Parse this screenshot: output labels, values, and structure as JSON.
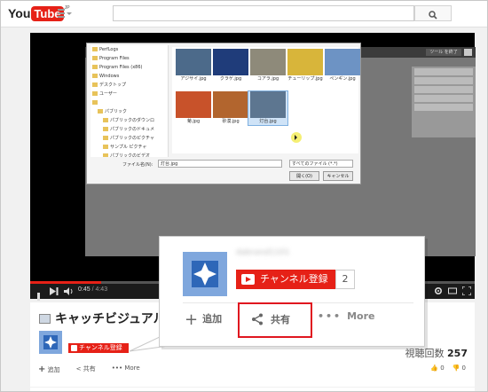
{
  "header": {
    "logo_you": "You",
    "logo_tube": "Tube",
    "logo_region": "JP"
  },
  "player": {
    "time_current": "0:45",
    "time_total": " / 4:43",
    "progress": 0.16,
    "screen_label": "ツール を終了",
    "dialog": {
      "tree": [
        "PerfLogs",
        "Program Files",
        "Program Files (x86)",
        "Windows",
        "デスクトップ",
        "ユーザー",
        "",
        "パブリック",
        "パブリックのダウンロ",
        "パブリックのドキュメ",
        "パブリックのピクチャ",
        "サンプル ピクチャ",
        "パブリックのビデオ",
        "パブリックのミュージ"
      ],
      "files": [
        {
          "caption": "アジサイ.jpg",
          "color": "#4c6a8a"
        },
        {
          "caption": "クラゲ.jpg",
          "color": "#1f3c7a"
        },
        {
          "caption": "コアラ.jpg",
          "color": "#8e8a7a"
        },
        {
          "caption": "チューリップ.jpg",
          "color": "#d8b53a"
        },
        {
          "caption": "ペンギン.jpg",
          "color": "#6d93c4"
        },
        {
          "caption": "菊.jpg",
          "color": "#c8522a"
        },
        {
          "caption": "砂漠.jpg",
          "color": "#b2652e"
        },
        {
          "caption": "灯台.jpg",
          "color": "#5d7690"
        }
      ],
      "filename_label": "ファイル名(N):",
      "filename_value": "灯台.jpg",
      "filetype_value": "すべてのファイル (*.*)",
      "open_label": "開く(O)",
      "cancel_label": "キャンセル"
    }
  },
  "video": {
    "title": "キャッチビジュアル作",
    "subscribe_small": "チャンネル登録",
    "views_label": "視聴回数",
    "views_count": "257",
    "action_add": "追加",
    "action_share": "共有",
    "action_more": "More",
    "likes": "0",
    "dislikes": "0"
  },
  "callout": {
    "channel_name": "dabrand1101",
    "subscribe_label": "チャンネル登録",
    "subscriber_count": "2",
    "add_label": "追加",
    "share_label": "共有",
    "more_label": "More"
  },
  "colors": {
    "youtube_red": "#e62117",
    "highlight_border": "#e0161f",
    "avatar_blue": "#7fa7dd"
  }
}
